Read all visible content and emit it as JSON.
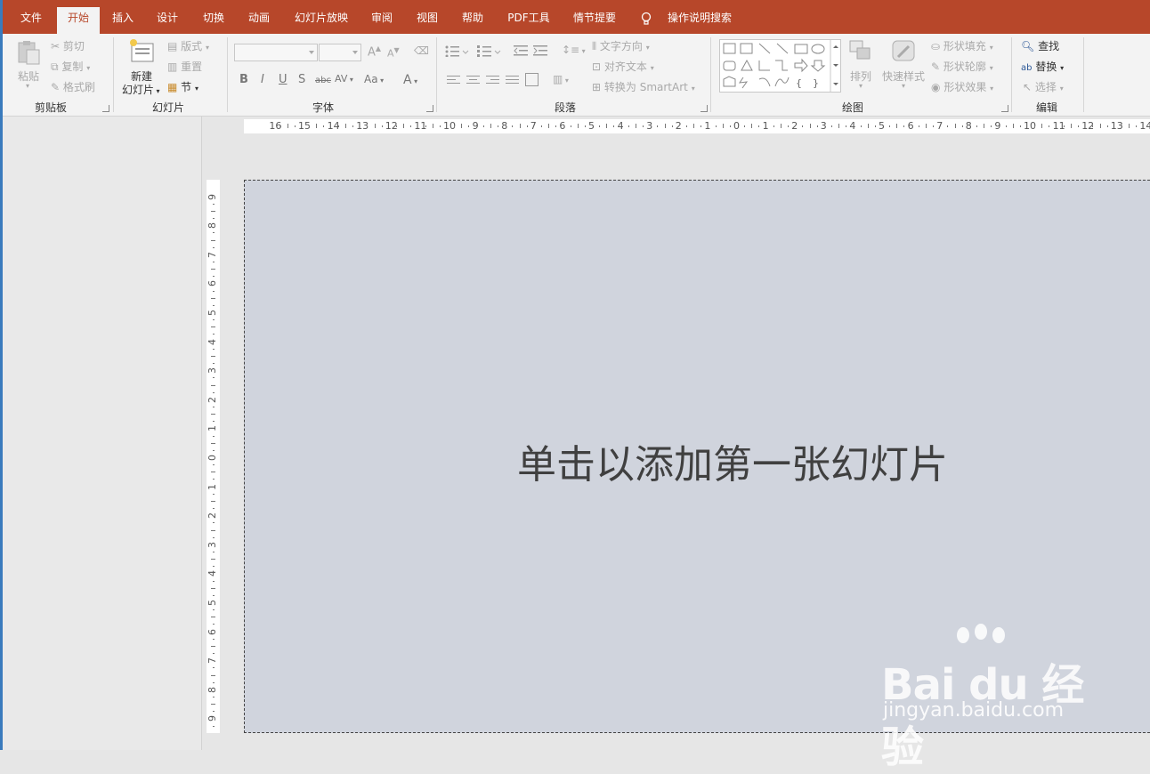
{
  "tabs": [
    "文件",
    "开始",
    "插入",
    "设计",
    "切换",
    "动画",
    "幻灯片放映",
    "审阅",
    "视图",
    "帮助",
    "PDF工具",
    "情节提要"
  ],
  "tell_me": "操作说明搜索",
  "clipboard": {
    "paste": "粘贴",
    "cut": "剪切",
    "copy": "复制",
    "format_painter": "格式刷",
    "group": "剪贴板"
  },
  "slides": {
    "new_slide_1": "新建",
    "new_slide_2": "幻灯片",
    "layout": "版式",
    "reset": "重置",
    "section": "节",
    "group": "幻灯片"
  },
  "font": {
    "group": "字体",
    "bold": "B",
    "italic": "I",
    "underline": "U",
    "shadow": "S",
    "strike": "abc",
    "spacing": "AV",
    "case": "Aa",
    "color": "A",
    "grow": "A",
    "shrink": "A"
  },
  "paragraph": {
    "group": "段落",
    "text_direction": "文字方向",
    "align_text": "对齐文本",
    "smartart": "转换为 SmartArt"
  },
  "drawing": {
    "group": "绘图",
    "arrange": "排列",
    "quick_styles": "快速样式",
    "shape_fill": "形状填充",
    "shape_outline": "形状轮廓",
    "shape_effects": "形状效果"
  },
  "editing": {
    "group": "编辑",
    "find": "查找",
    "replace": "替换",
    "select": "选择"
  },
  "slide_placeholder": "单击以添加第一张幻灯片",
  "watermark": {
    "logo": "Bai du 经验",
    "url": "jingyan.baidu.com"
  },
  "colors": {
    "accent": "#b7472a",
    "slide_bg": "#d0d4dd"
  }
}
